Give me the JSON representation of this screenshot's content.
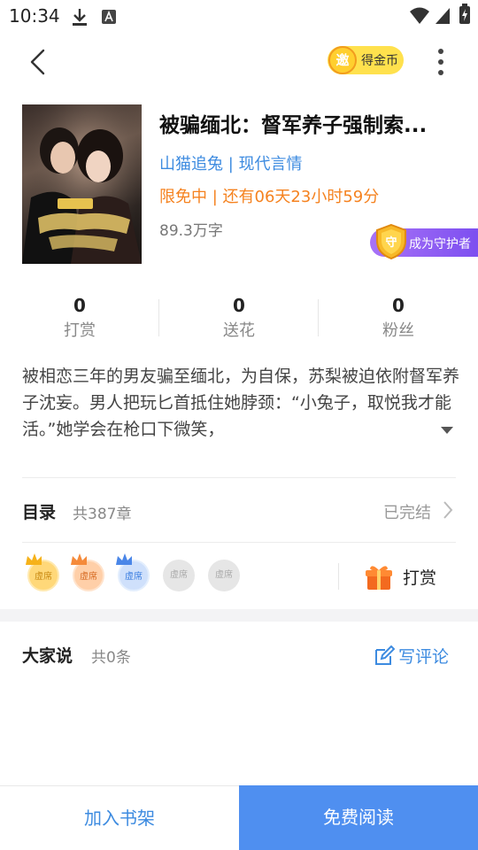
{
  "status_bar": {
    "time": "10:34"
  },
  "header": {
    "coin_badge": "邀",
    "coin_label": "得金币"
  },
  "book": {
    "title": "被骗缅北：督军养子强制索...",
    "author": "山猫追兔",
    "separator": " | ",
    "category": "现代言情",
    "free_label": "限免中",
    "free_remaining": "还有06天23小时59分",
    "word_count": "89.3万字",
    "guard_label": "成为守护者",
    "guard_badge": "守"
  },
  "stats": [
    {
      "value": "0",
      "label": "打赏"
    },
    {
      "value": "0",
      "label": "送花"
    },
    {
      "value": "0",
      "label": "粉丝"
    }
  ],
  "synopsis": "被相恋三年的男友骗至缅北，为自保，苏梨被迫依附督军养子沈妄。男人把玩匕首抵住她脖颈：“小兔子，取悦我才能活。”她学会在枪口下微笑，",
  "toc": {
    "title": "目录",
    "count": "共387章",
    "status": "已完结"
  },
  "seats": {
    "label": "虚席"
  },
  "reward": {
    "label": "打赏"
  },
  "comments": {
    "title": "大家说",
    "count": "共0条",
    "write_label": "写评论"
  },
  "bottom_bar": {
    "add_shelf": "加入书架",
    "read_free": "免费阅读"
  },
  "colors": {
    "accent": "#3d8be0",
    "orange": "#f5821f",
    "primary_button": "#4f8ff0",
    "coin_yellow": "#ffe14d",
    "guard_purple": "#8b5cf6"
  }
}
